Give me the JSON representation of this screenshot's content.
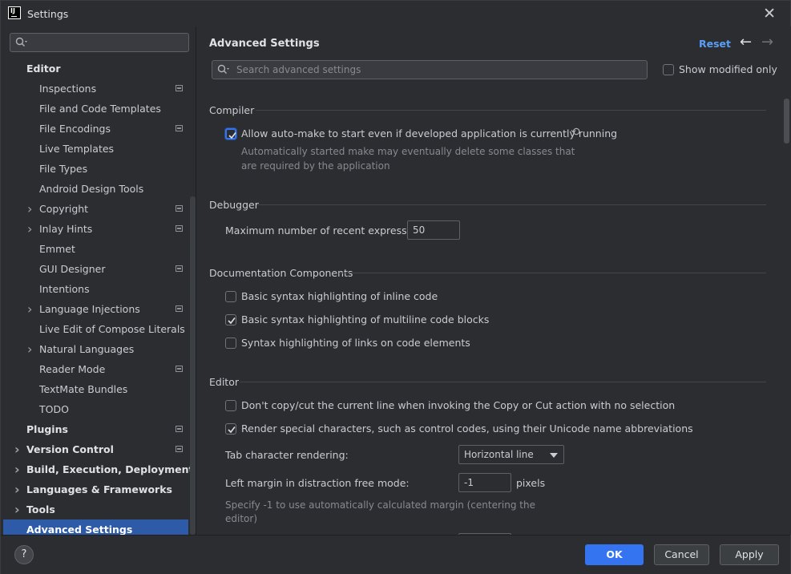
{
  "window": {
    "title": "Settings",
    "app_icon_text": "IJ"
  },
  "sidebar": {
    "items": [
      {
        "label": "Editor",
        "level": 0,
        "expandable": false,
        "modified": false
      },
      {
        "label": "Inspections",
        "level": 1,
        "expandable": false,
        "modified": true
      },
      {
        "label": "File and Code Templates",
        "level": 1,
        "expandable": false,
        "modified": false
      },
      {
        "label": "File Encodings",
        "level": 1,
        "expandable": false,
        "modified": true
      },
      {
        "label": "Live Templates",
        "level": 1,
        "expandable": false,
        "modified": false
      },
      {
        "label": "File Types",
        "level": 1,
        "expandable": false,
        "modified": false
      },
      {
        "label": "Android Design Tools",
        "level": 1,
        "expandable": false,
        "modified": false
      },
      {
        "label": "Copyright",
        "level": 1,
        "expandable": true,
        "modified": true
      },
      {
        "label": "Inlay Hints",
        "level": 1,
        "expandable": true,
        "modified": true
      },
      {
        "label": "Emmet",
        "level": 1,
        "expandable": false,
        "modified": false
      },
      {
        "label": "GUI Designer",
        "level": 1,
        "expandable": false,
        "modified": true
      },
      {
        "label": "Intentions",
        "level": 1,
        "expandable": false,
        "modified": false
      },
      {
        "label": "Language Injections",
        "level": 1,
        "expandable": true,
        "modified": true
      },
      {
        "label": "Live Edit of Compose Literals",
        "level": 1,
        "expandable": false,
        "modified": false
      },
      {
        "label": "Natural Languages",
        "level": 1,
        "expandable": true,
        "modified": false
      },
      {
        "label": "Reader Mode",
        "level": 1,
        "expandable": false,
        "modified": true
      },
      {
        "label": "TextMate Bundles",
        "level": 1,
        "expandable": false,
        "modified": false
      },
      {
        "label": "TODO",
        "level": 1,
        "expandable": false,
        "modified": false
      },
      {
        "label": "Plugins",
        "level": 0,
        "expandable": false,
        "modified": true
      },
      {
        "label": "Version Control",
        "level": 0,
        "expandable": true,
        "modified": true
      },
      {
        "label": "Build, Execution, Deployment",
        "level": 0,
        "expandable": true,
        "modified": false
      },
      {
        "label": "Languages & Frameworks",
        "level": 0,
        "expandable": true,
        "modified": false
      },
      {
        "label": "Tools",
        "level": 0,
        "expandable": true,
        "modified": false
      },
      {
        "label": "Advanced Settings",
        "level": 0,
        "expandable": false,
        "modified": false,
        "selected": true
      }
    ]
  },
  "main": {
    "title": "Advanced Settings",
    "reset_label": "Reset",
    "search_placeholder": "Search advanced settings",
    "show_modified_label": "Show modified only",
    "compiler": {
      "header": "Compiler",
      "auto_make_label": "Allow auto-make to start even if developed application is currently running",
      "auto_make_desc_1": "Automatically started make may eventually delete some classes that",
      "auto_make_desc_2": "are required by the application"
    },
    "debugger": {
      "header": "Debugger",
      "max_expr_label": "Maximum number of recent expressions:",
      "max_expr_value": "50"
    },
    "docs": {
      "header": "Documentation Components",
      "inline_label": "Basic syntax highlighting of inline code",
      "multiline_label": "Basic syntax highlighting of multiline code blocks",
      "links_label": "Syntax highlighting of links on code elements"
    },
    "editor": {
      "header": "Editor",
      "no_copy_label": "Don't copy/cut the current line when invoking the Copy or Cut action with no selection",
      "render_special_label": "Render special characters, such as control codes, using their Unicode name abbreviations",
      "tab_render_label": "Tab character rendering:",
      "tab_render_value": "Horizontal line",
      "left_margin_label": "Left margin in distraction free mode:",
      "left_margin_value": "-1",
      "left_margin_unit": "pixels",
      "left_margin_desc_1": "Specify -1 to use automatically calculated margin (centering the",
      "left_margin_desc_2": "editor)"
    }
  },
  "footer": {
    "help_label": "?",
    "ok_label": "OK",
    "cancel_label": "Cancel",
    "apply_label": "Apply"
  },
  "colors": {
    "background": "#2b2d30",
    "selection": "#2e5ba8",
    "accent": "#3574f0",
    "link": "#5b9ef5"
  }
}
